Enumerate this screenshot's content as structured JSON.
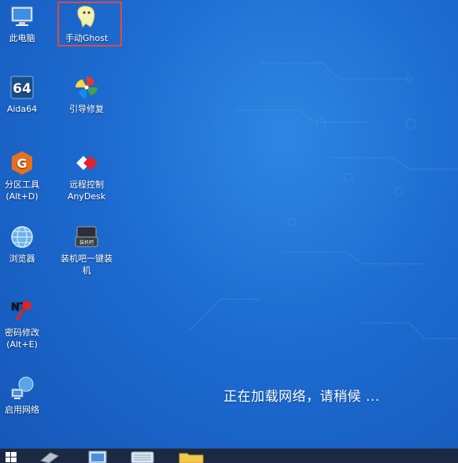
{
  "desktop": {
    "icons": [
      {
        "name": "此电脑",
        "icon": "computer-icon"
      },
      {
        "name": "手动Ghost",
        "icon": "ghost-icon"
      },
      {
        "name": "Aida64",
        "icon": "aida64-icon"
      },
      {
        "name": "引导修复",
        "icon": "pinwheel-icon"
      },
      {
        "name": "分区工具\n(Alt+D)",
        "icon": "partition-tool-icon"
      },
      {
        "name": "远程控制\nAnyDesk",
        "icon": "anydesk-icon"
      },
      {
        "name": "浏览器",
        "icon": "globe-icon"
      },
      {
        "name": "装机吧一键装\n机",
        "icon": "zhuangjiba-icon"
      },
      {
        "name": "密码修改\n(Alt+E)",
        "icon": "password-key-icon"
      },
      {
        "name": "启用网络",
        "icon": "network-icon"
      }
    ],
    "icon_badges": {
      "aida": "64",
      "partition": "G",
      "zhuangjiba": "装机吧",
      "password": "NT"
    }
  },
  "status": {
    "loading_text": "正在加载网络，请稍候 ..."
  },
  "colors": {
    "desktop_bg": "#1d6bd0",
    "selection_border": "#e04848",
    "taskbar": "#1b2a42"
  }
}
